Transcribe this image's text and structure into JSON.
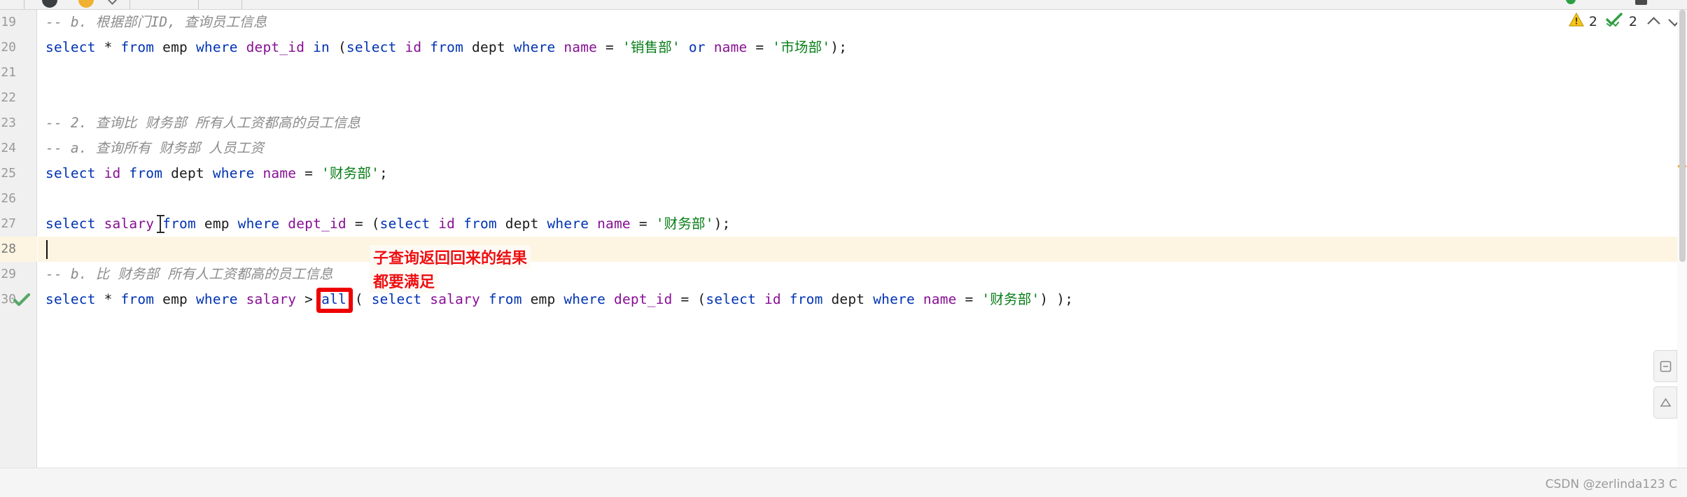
{
  "toolbar": {
    "icons": [
      "back-arrow-icon",
      "avatar-icon",
      "run-icon",
      "dropdown-chevron-icon",
      "green-status-dot-icon",
      "panel-icon"
    ]
  },
  "inspection": {
    "warning_icon": "warning-triangle-icon",
    "warning_count": "2",
    "ok_icon": "green-double-check-icon",
    "ok_count": "2",
    "prev_icon": "chevron-up-icon",
    "next_icon": "chevron-down-icon"
  },
  "editor": {
    "active_line_number": "28",
    "gutter": {
      "line_numbers": [
        "19",
        "20",
        "21",
        "22",
        "23",
        "24",
        "25",
        "26",
        "27",
        "28",
        "29",
        "30"
      ],
      "run_marker_icon": "green-check-run-icon",
      "run_marker_line": "30"
    },
    "lines": [
      {
        "number": "19",
        "tokens": [
          {
            "type": "cm",
            "text": "-- b. 根据部门ID, 查询员工信息"
          }
        ]
      },
      {
        "number": "20",
        "tokens": [
          {
            "type": "k",
            "text": "select"
          },
          {
            "type": "op",
            "text": " * "
          },
          {
            "type": "k",
            "text": "from"
          },
          {
            "type": "tb",
            "text": " emp "
          },
          {
            "type": "k",
            "text": "where"
          },
          {
            "type": "id",
            "text": " dept_id "
          },
          {
            "type": "k",
            "text": "in"
          },
          {
            "type": "p",
            "text": " ("
          },
          {
            "type": "k",
            "text": "select"
          },
          {
            "type": "id",
            "text": " id "
          },
          {
            "type": "k",
            "text": "from"
          },
          {
            "type": "tb",
            "text": " dept "
          },
          {
            "type": "k",
            "text": "where"
          },
          {
            "type": "id",
            "text": " name "
          },
          {
            "type": "op",
            "text": "= "
          },
          {
            "type": "s",
            "text": "'销售部'"
          },
          {
            "type": "k",
            "text": " or"
          },
          {
            "type": "id",
            "text": " name "
          },
          {
            "type": "op",
            "text": "= "
          },
          {
            "type": "s",
            "text": "'市场部'"
          },
          {
            "type": "p",
            "text": ");"
          }
        ]
      },
      {
        "number": "21",
        "tokens": []
      },
      {
        "number": "22",
        "tokens": []
      },
      {
        "number": "23",
        "tokens": [
          {
            "type": "cm",
            "text": "-- 2. 查询比 财务部 所有人工资都高的员工信息"
          }
        ]
      },
      {
        "number": "24",
        "tokens": [
          {
            "type": "cm",
            "text": "-- a. 查询所有 财务部 人员工资"
          }
        ]
      },
      {
        "number": "25",
        "tokens": [
          {
            "type": "k",
            "text": "select"
          },
          {
            "type": "id",
            "text": " id "
          },
          {
            "type": "k",
            "text": "from"
          },
          {
            "type": "tb",
            "text": " dept "
          },
          {
            "type": "k",
            "text": "where"
          },
          {
            "type": "id",
            "text": " name "
          },
          {
            "type": "op",
            "text": "= "
          },
          {
            "type": "s",
            "text": "'财务部'"
          },
          {
            "type": "p",
            "text": ";"
          }
        ]
      },
      {
        "number": "26",
        "tokens": []
      },
      {
        "number": "27",
        "tokens": [
          {
            "type": "k",
            "text": "select"
          },
          {
            "type": "id",
            "text": " salary "
          },
          {
            "type": "k",
            "text": "from"
          },
          {
            "type": "tb",
            "text": " emp "
          },
          {
            "type": "k",
            "text": "where"
          },
          {
            "type": "id",
            "text": " dept_id "
          },
          {
            "type": "op",
            "text": "= "
          },
          {
            "type": "p",
            "text": "("
          },
          {
            "type": "k",
            "text": "select"
          },
          {
            "type": "id",
            "text": " id "
          },
          {
            "type": "k",
            "text": "from"
          },
          {
            "type": "tb",
            "text": " dept "
          },
          {
            "type": "k",
            "text": "where"
          },
          {
            "type": "id",
            "text": " name "
          },
          {
            "type": "op",
            "text": "= "
          },
          {
            "type": "s",
            "text": "'财务部'"
          },
          {
            "type": "p",
            "text": ");"
          }
        ]
      },
      {
        "number": "28",
        "tokens": []
      },
      {
        "number": "29",
        "tokens": [
          {
            "type": "cm",
            "text": "-- b. 比 财务部 所有人工资都高的员工信息"
          }
        ]
      },
      {
        "number": "30",
        "tokens": [
          {
            "type": "k",
            "text": "select"
          },
          {
            "type": "op",
            "text": " * "
          },
          {
            "type": "k",
            "text": "from"
          },
          {
            "type": "tb",
            "text": " emp "
          },
          {
            "type": "k",
            "text": "where"
          },
          {
            "type": "id",
            "text": " salary "
          },
          {
            "type": "op",
            "text": "> "
          },
          {
            "type": "k",
            "text": "all"
          },
          {
            "type": "p",
            "text": " ( "
          },
          {
            "type": "k",
            "text": "select"
          },
          {
            "type": "id",
            "text": " salary "
          },
          {
            "type": "k",
            "text": "from"
          },
          {
            "type": "tb",
            "text": " emp "
          },
          {
            "type": "k",
            "text": "where"
          },
          {
            "type": "id",
            "text": " dept_id "
          },
          {
            "type": "op",
            "text": "= "
          },
          {
            "type": "p",
            "text": "("
          },
          {
            "type": "k",
            "text": "select"
          },
          {
            "type": "id",
            "text": " id "
          },
          {
            "type": "k",
            "text": "from"
          },
          {
            "type": "tb",
            "text": " dept "
          },
          {
            "type": "k",
            "text": "where"
          },
          {
            "type": "id",
            "text": " name "
          },
          {
            "type": "op",
            "text": "= "
          },
          {
            "type": "s",
            "text": "'财务部'"
          },
          {
            "type": "p",
            "text": ") );"
          }
        ]
      }
    ]
  },
  "annotations": {
    "line_1": "子查询返回回来的结果",
    "line_2": "都要满足",
    "highlight_keyword": "all",
    "highlight_color": "#ee0000",
    "text_color": "#ee1111"
  },
  "colors": {
    "keyword": "#0033b3",
    "identifier": "#871094",
    "string": "#067d17",
    "comment": "#8c8c8c",
    "active_line": "#fdf5e2",
    "gutter_bg": "#f0f0f0"
  },
  "watermark": {
    "text": "CSDN @zerlinda123 C"
  }
}
